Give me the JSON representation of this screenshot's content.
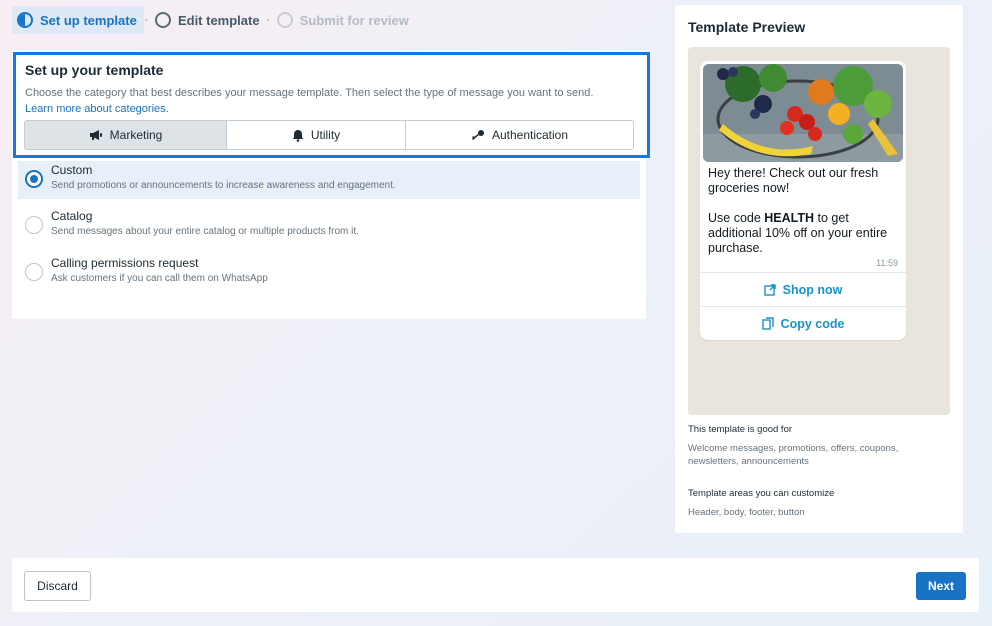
{
  "stepper": {
    "steps": [
      {
        "label": "Set up template",
        "state": "active"
      },
      {
        "label": "Edit template",
        "state": "current"
      },
      {
        "label": "Submit for review",
        "state": "future"
      }
    ]
  },
  "setup": {
    "title": "Set up your template",
    "description": "Choose the category that best describes your message template. Then select the type of message you want to send.",
    "link": "Learn more about categories.",
    "categories": [
      {
        "label": "Marketing",
        "icon": "megaphone-icon",
        "selected": true
      },
      {
        "label": "Utility",
        "icon": "bell-icon",
        "selected": false
      },
      {
        "label": "Authentication",
        "icon": "key-icon",
        "selected": false
      }
    ]
  },
  "options": [
    {
      "label": "Custom",
      "description": "Send promotions or announcements to increase awareness and engagement.",
      "selected": true
    },
    {
      "label": "Catalog",
      "description": "Send messages about your entire catalog or multiple products from it.",
      "selected": false
    },
    {
      "label": "Calling permissions request",
      "description": "Ask customers if you can call them on WhatsApp",
      "selected": false
    }
  ],
  "preview": {
    "title": "Template Preview",
    "message_line1": "Hey there! Check out our fresh groceries now!",
    "message_prefix": "Use code ",
    "message_code": "HEALTH",
    "message_suffix": " to get additional 10% off on your entire purchase.",
    "time": "11:59",
    "buttons": [
      {
        "label": "Shop now",
        "icon": "external-link-icon"
      },
      {
        "label": "Copy code",
        "icon": "copy-icon"
      }
    ],
    "good_for_title": "This template is good for",
    "good_for_text": "Welcome messages, promotions, offers, coupons, newsletters, announcements",
    "areas_title": "Template areas you can customize",
    "areas_text": "Header, body, footer, button"
  },
  "footer": {
    "discard_label": "Discard",
    "next_label": "Next"
  },
  "colors": {
    "accent": "#1873c4",
    "highlight_border": "#1877e8",
    "whatsapp_link": "#1794c9"
  }
}
